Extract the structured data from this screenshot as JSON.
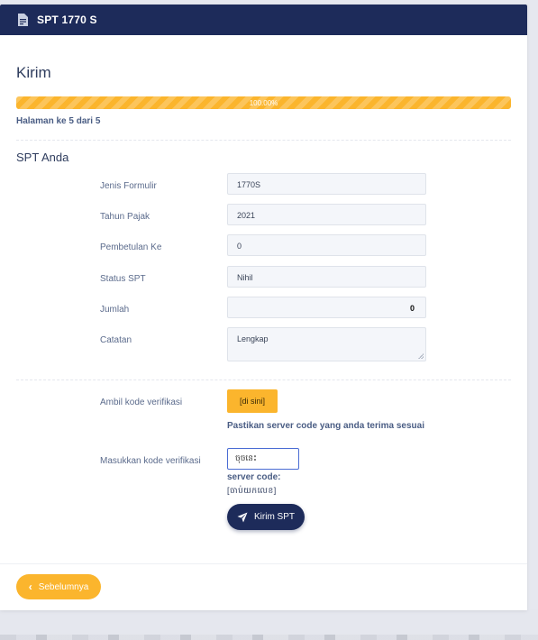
{
  "header": {
    "title": "SPT 1770 S",
    "icon": "document-icon"
  },
  "section_title": "Kirim",
  "progress": {
    "label": "100.00%",
    "value": 100,
    "color": "#fbb52d"
  },
  "page_info": "Halaman ke 5 dari 5",
  "spt_title": "SPT Anda",
  "form": {
    "jenis_formulir": {
      "label": "Jenis Formulir",
      "value": "1770S"
    },
    "tahun_pajak": {
      "label": "Tahun Pajak",
      "value": "2021"
    },
    "pembetulan_ke": {
      "label": "Pembetulan Ke",
      "value": "0"
    },
    "status_spt": {
      "label": "Status SPT",
      "value": "Nihil"
    },
    "jumlah": {
      "label": "Jumlah",
      "value": "0"
    },
    "catatan": {
      "label": "Catatan",
      "value": "Lengkap"
    }
  },
  "verification": {
    "get_code_label": "Ambil kode verifikasi",
    "get_code_button": "[di sini]",
    "note": "Pastikan server code yang anda terima sesuai",
    "enter_code_label": "Masukkan kode verifikasi",
    "input_value": "ចុចនេះ",
    "server_code_label": "server code:",
    "server_code_value": "[ចាប់យកលេខ]"
  },
  "buttons": {
    "submit": "Kirim SPT",
    "previous": "Sebelumnya"
  },
  "colors": {
    "primary": "#1d2b5a",
    "accent": "#fbb52d"
  }
}
